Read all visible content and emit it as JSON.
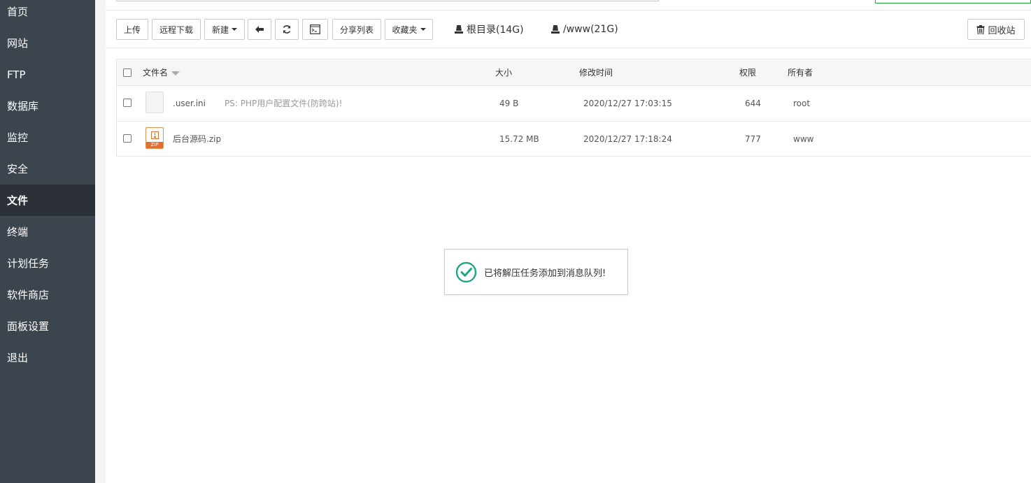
{
  "sidebar": {
    "items": [
      {
        "label": "首页"
      },
      {
        "label": "网站"
      },
      {
        "label": "FTP"
      },
      {
        "label": "数据库"
      },
      {
        "label": "监控"
      },
      {
        "label": "安全"
      },
      {
        "label": "文件"
      },
      {
        "label": "终端"
      },
      {
        "label": "计划任务"
      },
      {
        "label": "软件商店"
      },
      {
        "label": "面板设置"
      },
      {
        "label": "退出"
      }
    ],
    "active": "文件"
  },
  "toolbar": {
    "upload": "上传",
    "remote_download": "远程下载",
    "new": "新建",
    "share_list": "分享列表",
    "favorites": "收藏夹",
    "recycle_bin": "回收站",
    "disks": [
      {
        "label": "根目录(14G)"
      },
      {
        "label": "/www(21G)"
      }
    ]
  },
  "table": {
    "headers": {
      "name": "文件名",
      "size": "大小",
      "mtime": "修改时间",
      "perm": "权限",
      "owner": "所有者"
    },
    "rows": [
      {
        "name": ".user.ini",
        "note": "PS: PHP用户配置文件(防跨站)!",
        "size": "49 B",
        "mtime": "2020/12/27 17:03:15",
        "perm": "644",
        "owner": "root",
        "icon": "file-icon"
      },
      {
        "name": "后台源码.zip",
        "note": "",
        "size": "15.72 MB",
        "mtime": "2020/12/27 17:18:24",
        "perm": "777",
        "owner": "www",
        "icon": "zip-icon",
        "icon_label": "ZIP"
      }
    ]
  },
  "toast": {
    "message": "已将解压任务添加到消息队列!"
  },
  "colors": {
    "sidebar_bg": "#3c444d",
    "sidebar_active": "#2c3138",
    "success": "#20a53a"
  }
}
